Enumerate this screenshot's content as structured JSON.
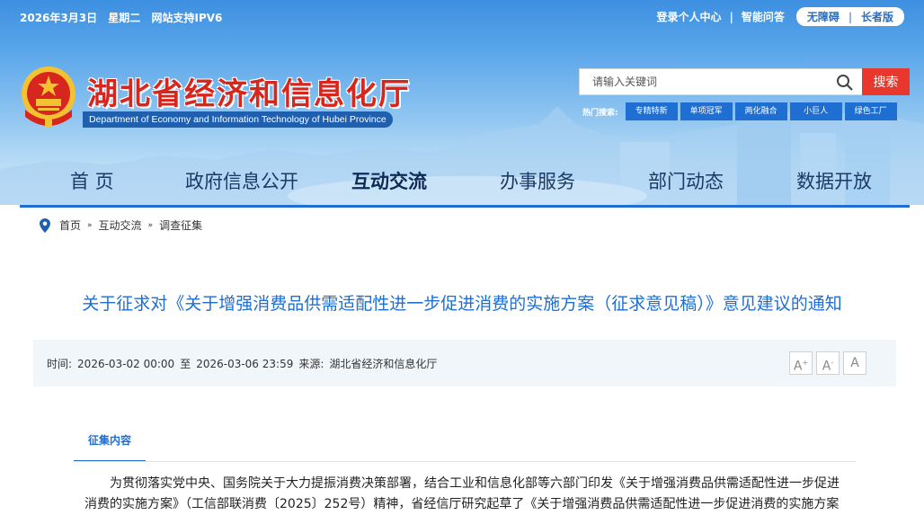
{
  "topbar": {
    "date": "2026年3月3日",
    "weekday": "星期二",
    "ipv6": "网站支持IPV6",
    "login": "登录个人中心",
    "qa": "智能问答",
    "accessible": "无障碍",
    "elder": "长者版"
  },
  "site": {
    "title": "湖北省经济和信息化厅",
    "subtitle": "Department of Economy and Information Technology of Hubei Province"
  },
  "search": {
    "placeholder": "请输入关键词",
    "button": "搜索",
    "hot_label": "热门搜索:",
    "hot_tags": [
      "专精特新",
      "单项冠军",
      "两化融合",
      "小巨人",
      "绿色工厂"
    ]
  },
  "nav": {
    "items": [
      "首  页",
      "政府信息公开",
      "互动交流",
      "办事服务",
      "部门动态",
      "数据开放"
    ],
    "active": "互动交流"
  },
  "breadcrumb": [
    "首页",
    "互动交流",
    "调查征集"
  ],
  "article": {
    "title": "关于征求对《关于增强消费品供需适配性进一步促进消费的实施方案（征求意见稿）》意见建议的通知",
    "time_label": "时间:",
    "time_start": "2026-03-02 00:00",
    "time_to": "至",
    "time_end": "2026-03-06 23:59",
    "source_label": "来源:",
    "source": "湖北省经济和信息化厅",
    "font_sizes": [
      "A+",
      "A-",
      "A"
    ],
    "tab": "征集内容",
    "paragraph": "为贯彻落实党中央、国务院关于大力提振消费决策部署，结合工业和信息化部等六部门印发《关于增强消费品供需适配性进一步促进消费的实施方案》（工信部联消费〔2025〕252号）精神，省经信厅研究起草了《关于增强消费品供需适配性进一步促进消费的实施方案"
  },
  "colors": {
    "brand_red": "#d7261d",
    "accent_blue": "#1f6ed1",
    "search_red": "#e8372c"
  }
}
